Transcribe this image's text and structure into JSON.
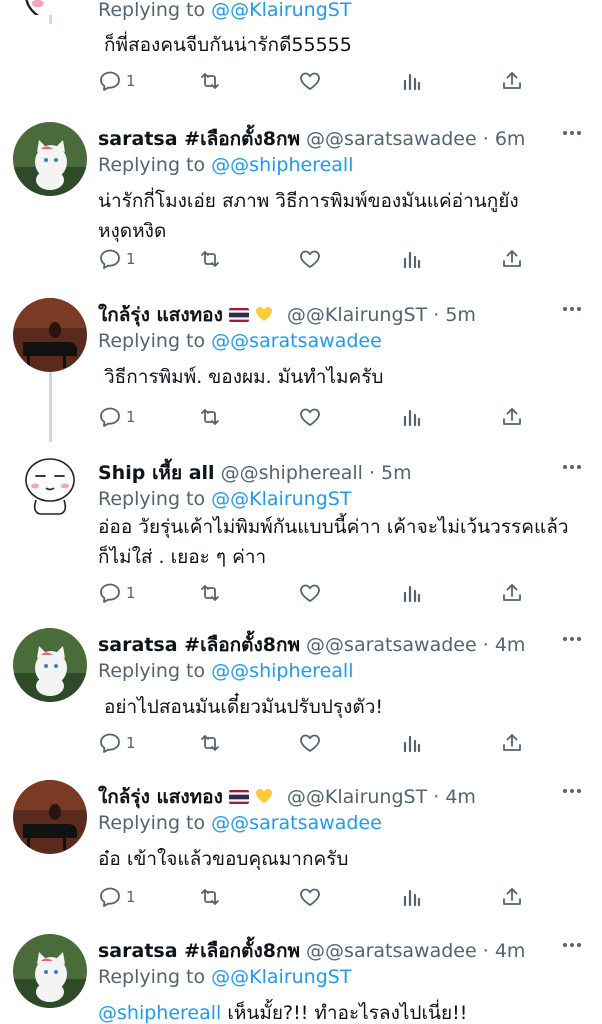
{
  "tweets": [
    {
      "id": "t0",
      "name": "",
      "handle": "",
      "time": "",
      "replying_prefix": "Replying to",
      "replying_to": "@@KlairungST",
      "text": "ก็พี่สองคนจีบกันน่ารักดี55555",
      "reply_count": "1",
      "avatar": "cartoon-icon"
    },
    {
      "id": "t1",
      "name": "saratsa #เลือกตั้ง8กพ",
      "handle": "@@saratsawadee",
      "time": "6m",
      "replying_prefix": "Replying to",
      "replying_to": "@@shiphereall",
      "text": "น่ารักกี่โมงเอ่ย  สภาพ วิธีการพิมพ์ของมันแค่อ่านกูยังหงุดหงิด",
      "reply_count": "1",
      "avatar": "cat-icon"
    },
    {
      "id": "t2",
      "name": "ใกล้รุ่ง แสงทอง",
      "handle": "@@KlairungST",
      "time": "5m",
      "replying_prefix": "Replying to",
      "replying_to": "@@saratsawadee",
      "text": "วิธีการพิมพ์. ของผม. มันทำไมครับ",
      "reply_count": "1",
      "avatar": "piano-icon"
    },
    {
      "id": "t3",
      "name": "Ship เหี้ย all",
      "handle": "@@shiphereall",
      "time": "5m",
      "replying_prefix": "Replying to",
      "replying_to": "@@KlairungST",
      "text": "อ่ออ วัยรุ่นเค้าไม่พิมพ์กันแบบนี้ค่าา เค้าจะไม่เว้นวรรคแล้วก็ไม่ใส่ . เยอะ ๆ ค่าา",
      "reply_count": "1",
      "avatar": "cartoon-icon"
    },
    {
      "id": "t4",
      "name": "saratsa #เลือกตั้ง8กพ",
      "handle": "@@saratsawadee",
      "time": "4m",
      "replying_prefix": "Replying to",
      "replying_to": "@@shiphereall",
      "text": "อย่าไปสอนมันเดี๋ยวมันปรับปรุงตัว!",
      "reply_count": "1",
      "avatar": "cat-icon"
    },
    {
      "id": "t5",
      "name": "ใกล้รุ่ง แสงทอง",
      "handle": "@@KlairungST",
      "time": "4m",
      "replying_prefix": "Replying to",
      "replying_to": "@@saratsawadee",
      "text": "อ๋อ เข้าใจแล้วขอบคุณมากครับ",
      "reply_count": "1",
      "avatar": "piano-icon"
    },
    {
      "id": "t6",
      "name": "saratsa #เลือกตั้ง8กพ",
      "handle": "@@saratsawadee",
      "time": "4m",
      "replying_prefix": "Replying to",
      "replying_to": "@@KlairungST",
      "text_mention": "@shiphereall",
      "text": " เห็นมั้ย?!! ทำอะไรลงไปเนี่ย!!",
      "reply_count": "",
      "avatar": "cat-icon"
    }
  ],
  "separator": "·",
  "colors": {
    "accent": "#1d9bf0",
    "muted": "#536471",
    "text": "#0f1419",
    "thread_line": "#cfd9de"
  }
}
